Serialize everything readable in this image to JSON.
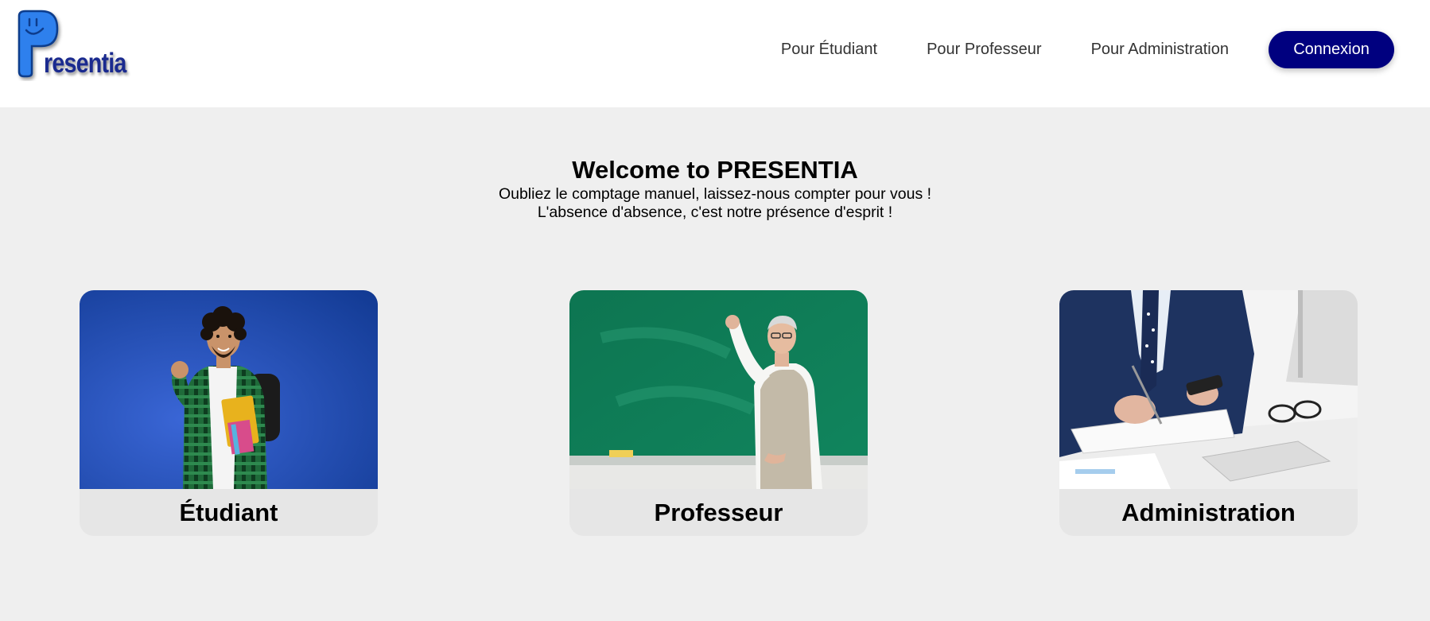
{
  "brand": {
    "logo_text": "resentia",
    "logo_color": "#1a2a8f",
    "logo_p_color": "#2f80ed"
  },
  "nav": {
    "items": [
      {
        "label": "Pour Étudiant"
      },
      {
        "label": "Pour Professeur"
      },
      {
        "label": "Pour Administration"
      }
    ],
    "login_label": "Connexion",
    "login_color": "#00007f"
  },
  "hero": {
    "title": "Welcome to PRESENTIA",
    "line1": "Oubliez le comptage manuel, laissez-nous compter pour vous !",
    "line2": "L'absence d'absence, c'est notre présence d'esprit !"
  },
  "cards": [
    {
      "label": "Étudiant",
      "image": "student-photo",
      "bg": "#1d45a8"
    },
    {
      "label": "Professeur",
      "image": "teacher-chalkboard-photo",
      "bg": "#12805e"
    },
    {
      "label": "Administration",
      "image": "office-desk-photo",
      "bg": "#f2f2f2"
    }
  ],
  "colors": {
    "page_bg": "#efefef",
    "header_bg": "#ffffff",
    "card_bg": "#e6e6e6"
  }
}
